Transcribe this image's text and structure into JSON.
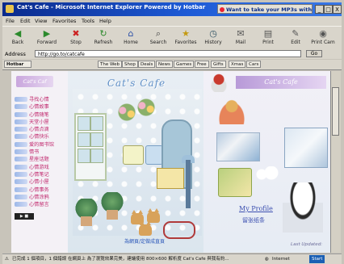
{
  "window": {
    "title": "Cat's Cafe - Microsoft Internet Explorer Powered by Hotbar",
    "ad_text": "Want to take your MP3s with you?",
    "buttons": [
      "_",
      "□",
      "X"
    ]
  },
  "menu": [
    "File",
    "Edit",
    "View",
    "Favorites",
    "Tools",
    "Help"
  ],
  "toolbar": [
    {
      "label": "Back",
      "icon": "back-arrow-icon"
    },
    {
      "label": "Forward",
      "icon": "forward-arrow-icon"
    },
    {
      "label": "Stop",
      "icon": "stop-icon"
    },
    {
      "label": "Refresh",
      "icon": "refresh-icon"
    },
    {
      "label": "Home",
      "icon": "home-icon"
    },
    {
      "label": "Search",
      "icon": "search-icon"
    },
    {
      "label": "Favorites",
      "icon": "favorites-icon"
    },
    {
      "label": "History",
      "icon": "history-icon"
    },
    {
      "label": "Mail",
      "icon": "mail-icon"
    },
    {
      "label": "Print",
      "icon": "print-icon"
    },
    {
      "label": "Edit",
      "icon": "edit-icon"
    },
    {
      "label": "Print Cam",
      "icon": "camera-icon"
    }
  ],
  "address": {
    "label": "Address",
    "url": "http://go.to/catcafe",
    "go": "Go"
  },
  "links_bar": [
    "Hotbar",
    "The Web",
    "Shop",
    "Deals",
    "News",
    "Games",
    "Free",
    "Gifts",
    "Xmas",
    "Cars"
  ],
  "page": {
    "logo_left": "Cat's Caf",
    "site_title": "Cat's Cafe",
    "right_title": "Cat's Cafe",
    "nav_items": [
      "寻找心情",
      "心情故事",
      "心情随笔",
      "天堂小屋",
      "心情点滴",
      "心情快乐",
      "爱的图书馆",
      "情书",
      "星座话题",
      "心情游戏",
      "心情笔记",
      "心情小屋",
      "心情事务",
      "心情涂鸦",
      "心情留言"
    ],
    "player_label": "▶ ■",
    "center_link": "為網頁/定做成直頁",
    "profile_link": "My Profile",
    "guestbook_link": "留张纸条",
    "last_updated": "Last Updated:"
  },
  "status": {
    "text": "已完成 1 個項目，1 個錯誤 在網頁上  為了瀏覽效果完美，建議使用 800×600 解析度  Cat's Cafe  與我有約...",
    "zone": "Internet",
    "taskbar": "Start"
  },
  "colors": {
    "titlebar_start": "#0a2a8c",
    "titlebar_end": "#3a78e6",
    "nav_text": "#c12a6f",
    "link_blue": "#3b4fb0"
  }
}
